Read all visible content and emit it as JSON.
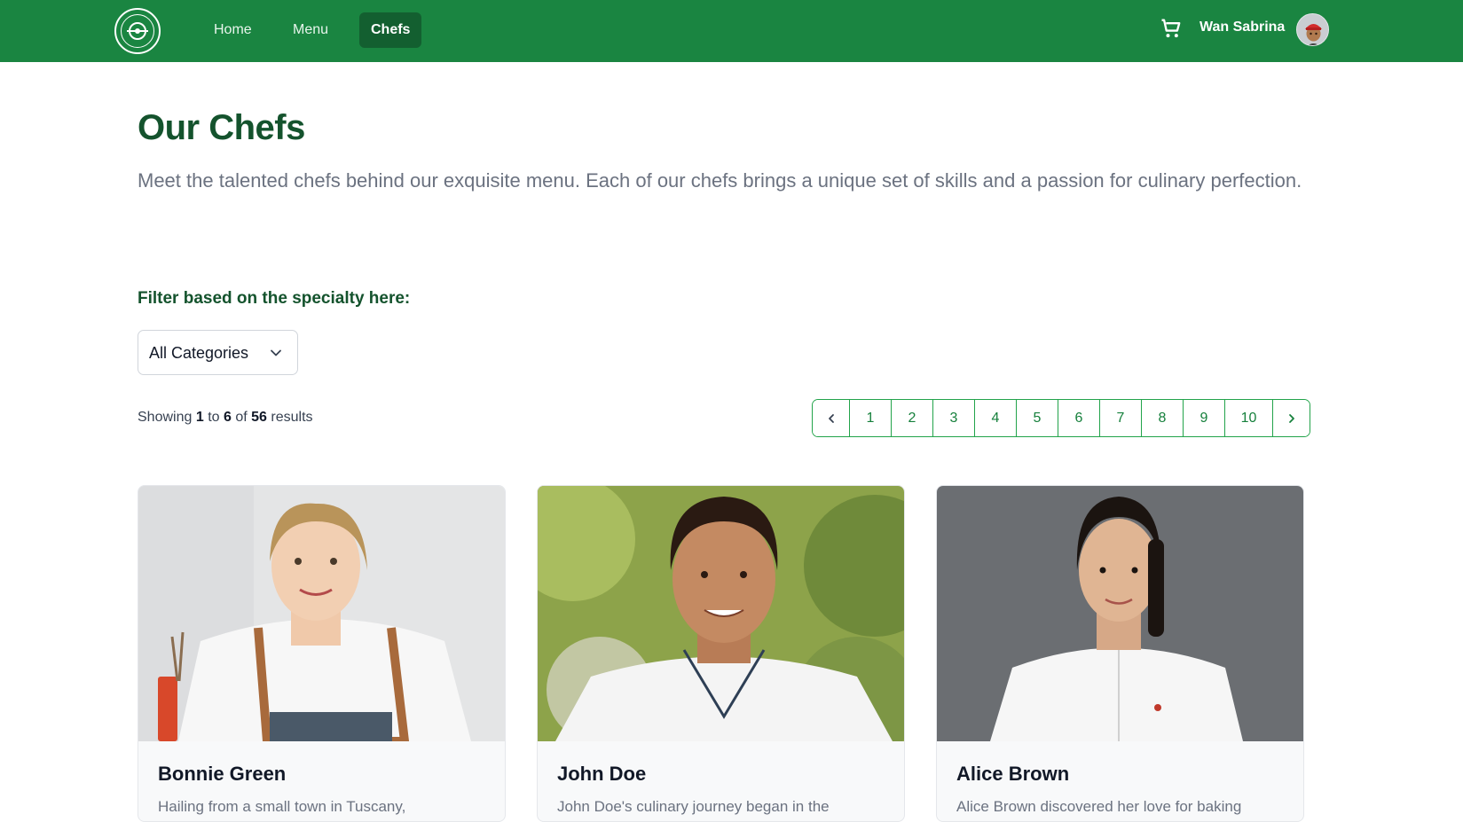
{
  "nav": {
    "home": "Home",
    "menu": "Menu",
    "chefs": "Chefs",
    "user_name": "Wan Sabrina",
    "icons": {
      "logo": "restaurant-logo",
      "cart": "cart-icon",
      "avatar": "user-avatar"
    },
    "brand_color": "#1a8541",
    "active_color": "#135f30"
  },
  "header": {
    "title": "Our Chefs",
    "description": "Meet the talented chefs behind our exquisite menu. Each of our chefs brings a unique set of skills and a passion for culinary perfection."
  },
  "filter": {
    "label": "Filter based on the specialty here:",
    "selected": "All Categories"
  },
  "results": {
    "prefix": "Showing",
    "from": "1",
    "to_word": "to",
    "to": "6",
    "of_word": "of",
    "total": "56",
    "suffix": "results"
  },
  "pagination": {
    "pages": [
      "1",
      "2",
      "3",
      "4",
      "5",
      "6",
      "7",
      "8",
      "9",
      "10"
    ],
    "icons": {
      "prev": "chevron-left-icon",
      "next": "chevron-right-icon"
    }
  },
  "chefs": [
    {
      "name": "Bonnie Green",
      "bio": "Hailing from a small town in Tuscany,"
    },
    {
      "name": "John Doe",
      "bio": "John Doe's culinary journey began in the"
    },
    {
      "name": "Alice Brown",
      "bio": "Alice Brown discovered her love for baking"
    }
  ]
}
